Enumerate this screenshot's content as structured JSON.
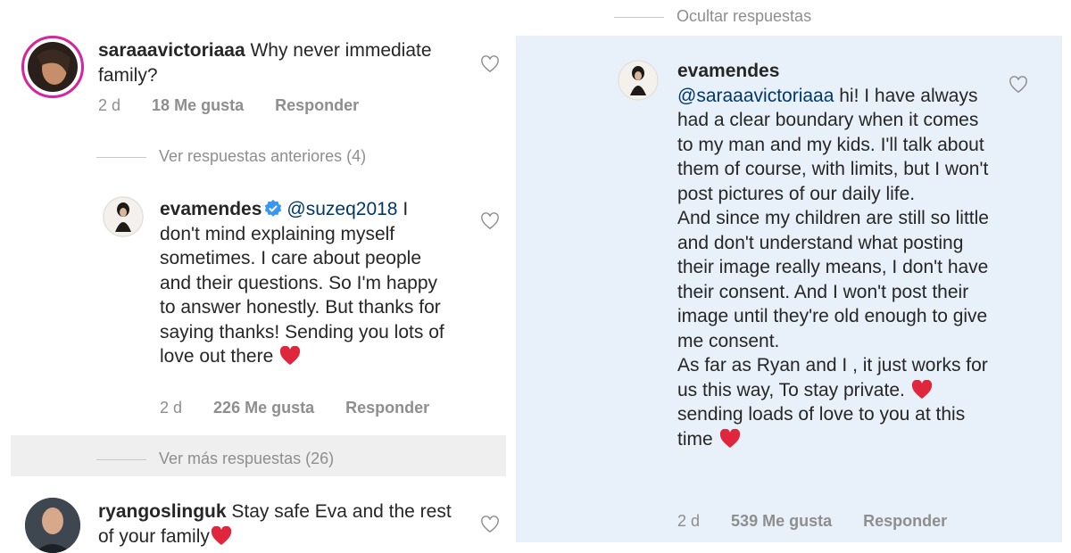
{
  "left": {
    "comment1": {
      "username": "saraaavictoriaaa",
      "text": " Why never immediate family?",
      "time": "2 d",
      "likes": "18 Me gusta",
      "reply": "Responder"
    },
    "view_previous": "Ver respuestas anteriores (4)",
    "reply1": {
      "username": "evamendes",
      "mention": "@suzeq2018",
      "text": " I don't mind explaining myself sometimes. I care about people and their questions. So I'm happy to answer honestly. But thanks for saying thanks! Sending you lots of love out there",
      "time": "2 d",
      "likes": "226 Me gusta",
      "reply": "Responder"
    },
    "view_more": "Ver más respuestas (26)",
    "comment2": {
      "username": "ryangoslinguk",
      "text": " Stay safe Eva and the rest of your family"
    }
  },
  "right": {
    "hide_replies": "Ocultar respuestas",
    "reply": {
      "username": "evamendes",
      "mention": "@saraaavictoriaaa",
      "text_l1": " hi! I have always had a clear boundary when it comes to my man and my kids. I'll talk about them of course, with limits, but I won't post pictures of our daily life.",
      "text_l2": "And since my children are still so little and don't understand what posting their image really means, I don't have their consent. And I won't post their image until they're old enough to give me consent.",
      "text_l3a": "As far as Ryan and I , it just works for us this way, To stay private. ",
      "text_l3b": "sending loads of love to you at this time ",
      "time": "2 d",
      "likes": "539 Me gusta",
      "reply": "Responder"
    }
  },
  "colors": {
    "heart": "#ed4956",
    "verified": "#3897f0",
    "highlight": "#e8f1fa",
    "gray_band": "#efefef"
  },
  "icons": [
    "heart-outline-icon",
    "verified-badge-icon",
    "red-heart-emoji"
  ]
}
